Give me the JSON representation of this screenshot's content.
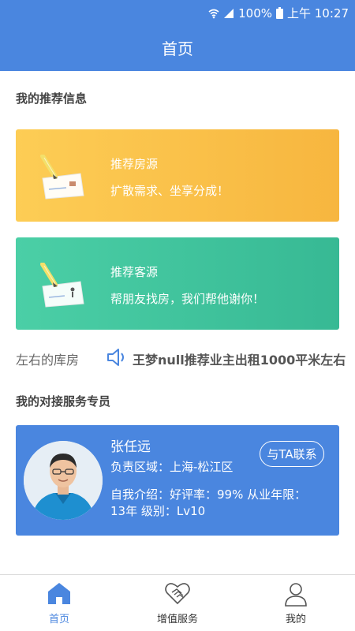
{
  "status_bar": {
    "battery": "100%",
    "time": "上午 10:27"
  },
  "header": {
    "title": "首页"
  },
  "recommend": {
    "title": "我的推荐信息",
    "cards": [
      {
        "title": "推荐房源",
        "subtitle": "扩散需求、坐享分成！",
        "color": "#f9c04a"
      },
      {
        "title": "推荐客源",
        "subtitle": "帮朋友找房，我们帮他谢你！",
        "color": "#3fc39d"
      }
    ]
  },
  "ticker": {
    "prev": "左右的库房",
    "message": "王梦null推荐业主出租1000平米左右"
  },
  "service": {
    "title": "我的对接服务专员",
    "agent": {
      "name": "张任远",
      "area": "负责区域：上海-松江区",
      "intro": "自我介绍：好评率：99%   从业年限：13年   级别：Lv10",
      "contact_label": "与TA联系"
    }
  },
  "tabs": [
    {
      "label": "首页",
      "icon": "home-icon",
      "active": true
    },
    {
      "label": "增值服务",
      "icon": "handshake-icon",
      "active": false
    },
    {
      "label": "我的",
      "icon": "user-icon",
      "active": false
    }
  ],
  "colors": {
    "primary": "#4a86df",
    "yellow": "#f9c04a",
    "green": "#3fc39d"
  }
}
